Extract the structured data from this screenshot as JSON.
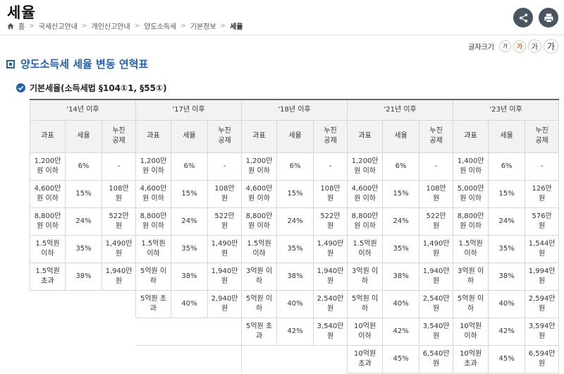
{
  "page": {
    "title": "세율"
  },
  "toolbar": {
    "share_icon": "share-icon",
    "print_icon": "print-icon"
  },
  "breadcrumb": {
    "home": "홈",
    "items": [
      "국세신고안내",
      "개인신고안내",
      "양도소득세",
      "기본정보"
    ],
    "current": "세율"
  },
  "font_size": {
    "label": "글자크기",
    "options": [
      "가",
      "가",
      "가",
      "가"
    ],
    "selected_index": 1
  },
  "section": {
    "title": "양도소득세 세율 변동 연혁표"
  },
  "subsection": {
    "title": "기본세율(소득세법 §104①1, §55①)"
  },
  "table": {
    "periods": [
      "'14년 이후",
      "'17년 이후",
      "'18년 이후",
      "'21년 이후",
      "'23년 이후"
    ],
    "subheaders": [
      "과표",
      "세율",
      "누진\n공제"
    ],
    "columns": [
      [
        [
          "1,200만\n원 이하",
          "6%",
          "-"
        ],
        [
          "4,600만\n원 이하",
          "15%",
          "108만\n원"
        ],
        [
          "8,800만\n원 이하",
          "24%",
          "522만\n원"
        ],
        [
          "1.5억원\n이하",
          "35%",
          "1,490만\n원"
        ],
        [
          "1.5억원\n초과",
          "38%",
          "1,940만\n원"
        ]
      ],
      [
        [
          "1,200만\n원 이하",
          "6%",
          "-"
        ],
        [
          "4,600만\n원 이하",
          "15%",
          "108만\n원"
        ],
        [
          "8,800만\n원 이하",
          "24%",
          "522만\n원"
        ],
        [
          "1.5억원\n이하",
          "35%",
          "1,490만\n원"
        ],
        [
          "5억원 이\n하",
          "38%",
          "1,940만\n원"
        ],
        [
          "5억원 초\n과",
          "40%",
          "2,940만\n원"
        ]
      ],
      [
        [
          "1,200만\n원 이하",
          "6%",
          "-"
        ],
        [
          "4,600만\n원 이하",
          "15%",
          "108만\n원"
        ],
        [
          "8,800만\n원 이하",
          "24%",
          "522만\n원"
        ],
        [
          "1.5억원\n이하",
          "35%",
          "1,490만\n원"
        ],
        [
          "3억원 이\n하",
          "38%",
          "1,940만\n원"
        ],
        [
          "5억원 이\n하",
          "40%",
          "2,540만\n원"
        ],
        [
          "5억원 초\n과",
          "42%",
          "3,540만\n원"
        ]
      ],
      [
        [
          "1,200만\n원 이하",
          "6%",
          "-"
        ],
        [
          "4,600만\n원 이하",
          "15%",
          "108만\n원"
        ],
        [
          "8,800만\n원 이하",
          "24%",
          "522만\n원"
        ],
        [
          "1.5억원\n이하",
          "35%",
          "1,490만\n원"
        ],
        [
          "3억원 이\n하",
          "38%",
          "1,940만\n원"
        ],
        [
          "5억원 이\n하",
          "40%",
          "2,540만\n원"
        ],
        [
          "10억원\n이하",
          "42%",
          "3,540만\n원"
        ],
        [
          "10억원\n초과",
          "45%",
          "6,540만\n원"
        ]
      ],
      [
        [
          "1,400만\n원 이하",
          "6%",
          "-"
        ],
        [
          "5,000만\n원 이하",
          "15%",
          "126만\n원"
        ],
        [
          "8,800만\n원 이하",
          "24%",
          "576만\n원"
        ],
        [
          "1.5억원\n이하",
          "35%",
          "1,544만\n원"
        ],
        [
          "3억원 이\n하",
          "38%",
          "1,994만\n원"
        ],
        [
          "5억원 이\n하",
          "40%",
          "2,594만\n원"
        ],
        [
          "10억원\n이하",
          "42%",
          "3,594만\n원"
        ],
        [
          "10억원\n초과",
          "45%",
          "6,594만\n원"
        ]
      ]
    ]
  }
}
